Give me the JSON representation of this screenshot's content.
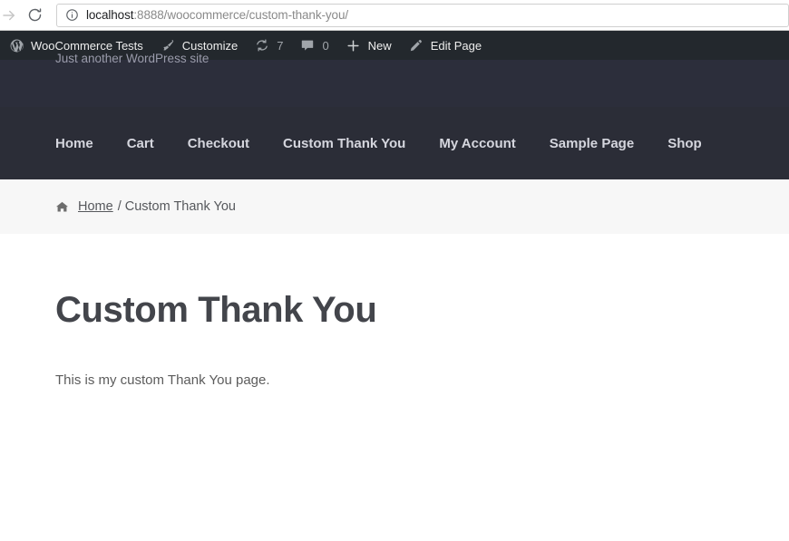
{
  "browser": {
    "forward_icon": "arrow-forward-icon",
    "reload_icon": "reload-icon",
    "info_icon": "page-info-icon",
    "url_host": "localhost",
    "url_rest": ":8888/woocommerce/custom-thank-you/",
    "url_full": "localhost:8888/woocommerce/custom-thank-you/"
  },
  "adminbar": {
    "background": "#23282d",
    "items": [
      {
        "icon": "wordpress-logo-icon",
        "label": "WooCommerce Tests",
        "count": ""
      },
      {
        "icon": "paintbrush-icon",
        "label": "Customize",
        "count": ""
      },
      {
        "icon": "update-arrows-icon",
        "label": "",
        "count": "7"
      },
      {
        "icon": "comment-bubble-icon",
        "label": "",
        "count": "0"
      },
      {
        "icon": "plus-icon",
        "label": "New",
        "count": ""
      },
      {
        "icon": "pencil-icon",
        "label": "Edit Page",
        "count": ""
      }
    ]
  },
  "site_header": {
    "background": "#2c2e3b",
    "tagline": "Just another WordPress site"
  },
  "nav": {
    "background": "#2b2d37",
    "items": [
      {
        "label": "Home"
      },
      {
        "label": "Cart"
      },
      {
        "label": "Checkout"
      },
      {
        "label": "Custom Thank You"
      },
      {
        "label": "My Account"
      },
      {
        "label": "Sample Page"
      },
      {
        "label": "Shop"
      }
    ]
  },
  "breadcrumb": {
    "background": "#f7f7f7",
    "home_icon": "home-icon",
    "home_label": "Home",
    "separator": "/",
    "current": "Custom Thank You"
  },
  "main": {
    "title": "Custom Thank You",
    "body_text": "This is my custom Thank You page."
  }
}
